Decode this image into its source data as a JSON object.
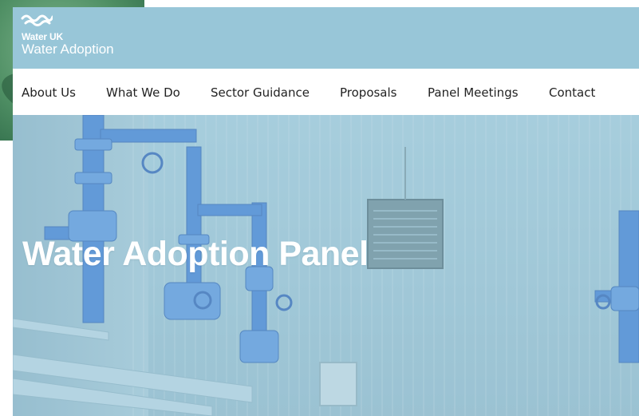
{
  "header": {
    "brand": "Water UK",
    "subtitle": "Water Adoption",
    "logo_icon": "waves-icon",
    "background": "#98c6d8"
  },
  "nav": {
    "items": [
      {
        "label": "About Us"
      },
      {
        "label": "What We Do"
      },
      {
        "label": "Sector Guidance"
      },
      {
        "label": "Proposals"
      },
      {
        "label": "Panel Meetings"
      },
      {
        "label": "Contact"
      }
    ]
  },
  "hero": {
    "title": "Water Adoption Panel",
    "image": "pipework-pump-room",
    "overlay_color": "#a7cddd"
  },
  "colors": {
    "accent_blue": "#2f6fd0",
    "text": "#222222"
  }
}
